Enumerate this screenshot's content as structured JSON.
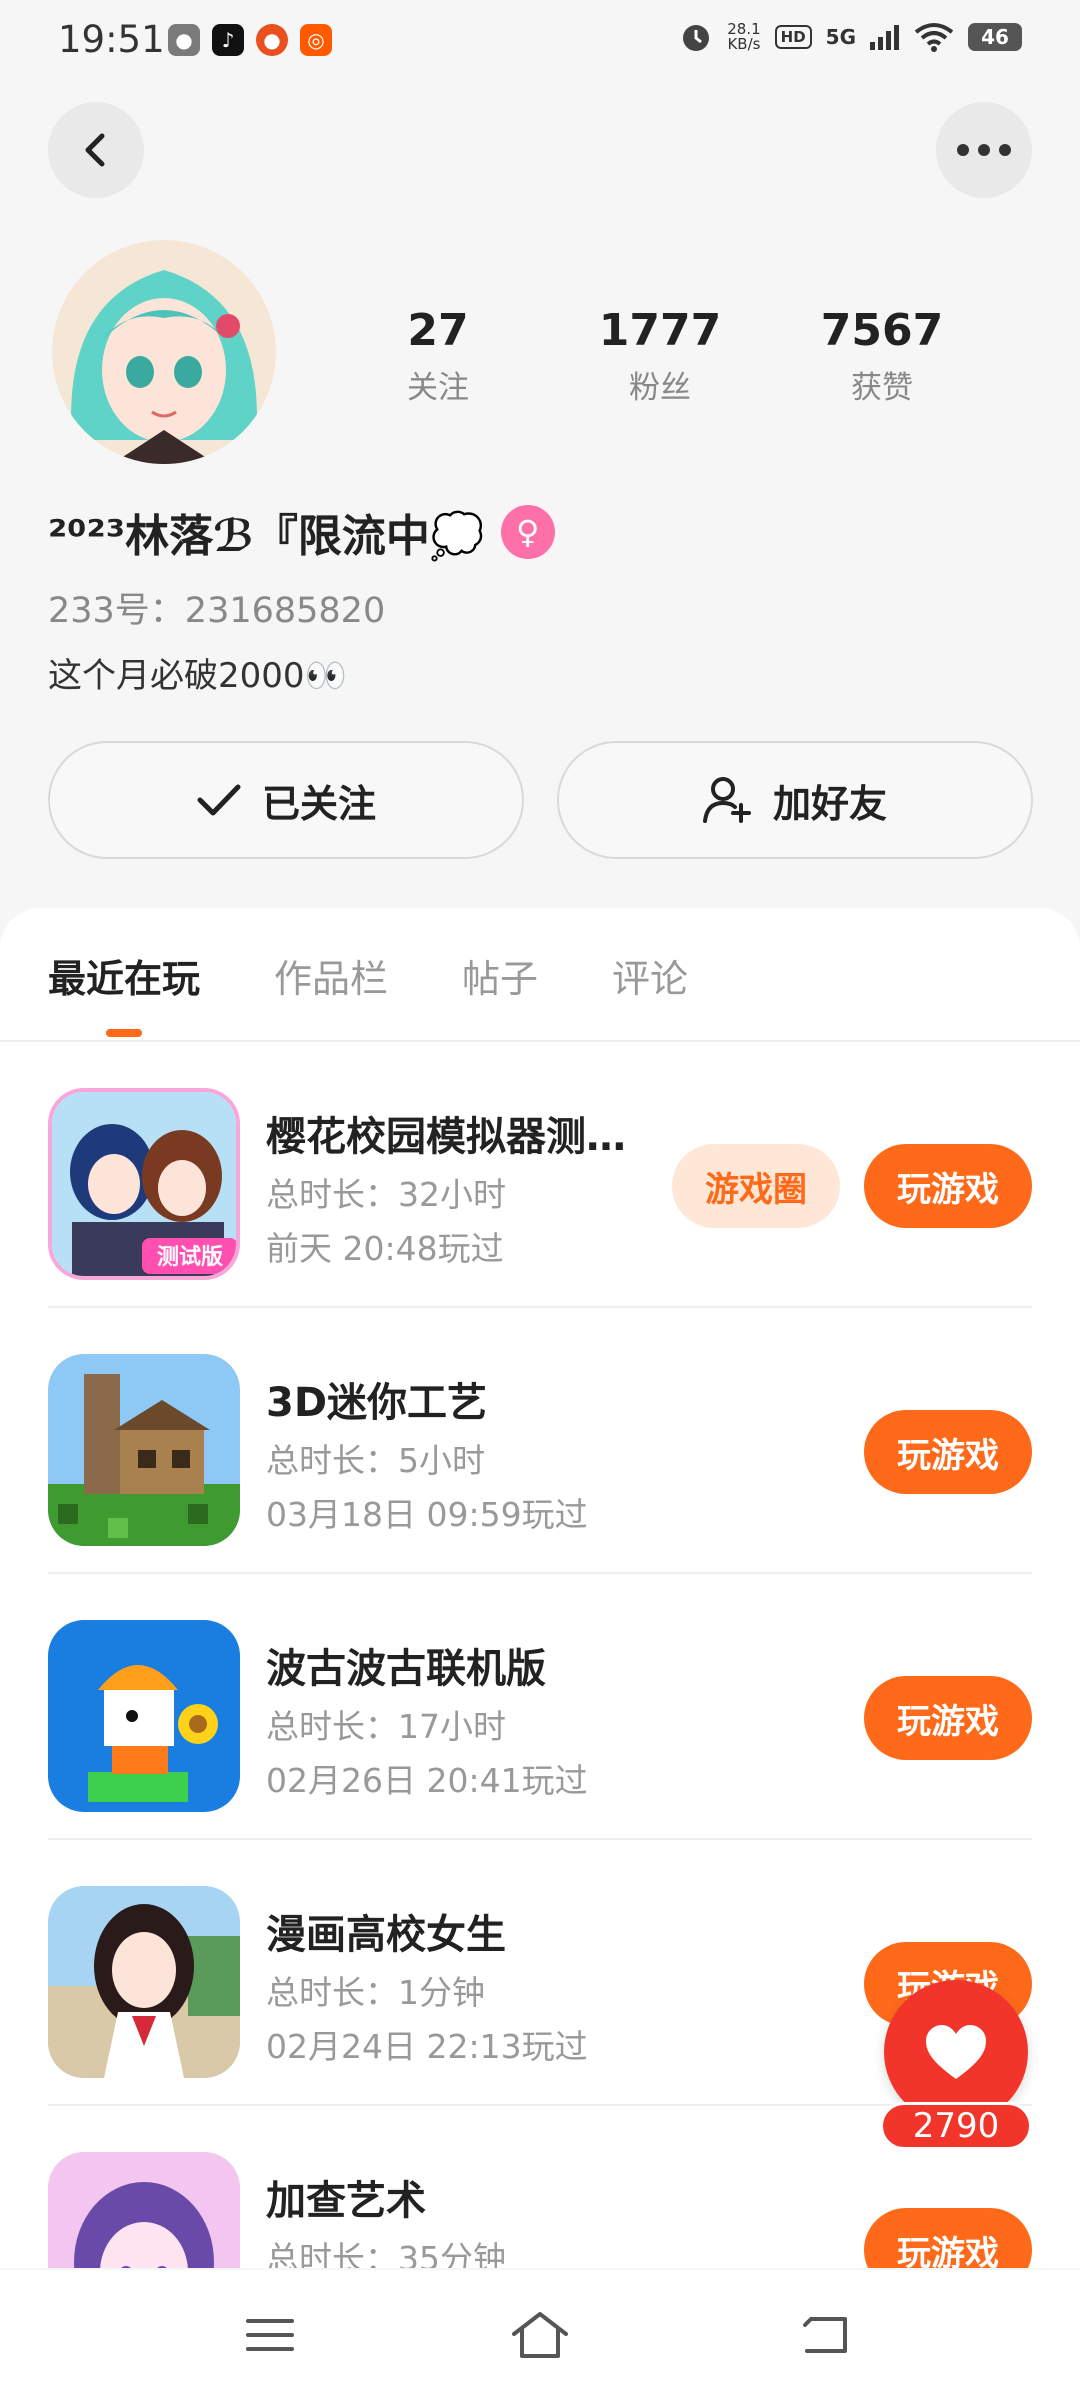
{
  "status_bar": {
    "time": "19:51",
    "speed_value": "28.1",
    "speed_unit": "KB/s",
    "hd": "HD",
    "network": "5G",
    "battery": "46",
    "app_icons": [
      "wechat-icon",
      "tiktok-icon",
      "weibo-icon",
      "taobao-icon"
    ]
  },
  "profile": {
    "nickname": "²⁰²³林落ℬ『限流中💭",
    "gender": "female",
    "user_id": "233号：231685820",
    "bio": "这个月必破2000👀",
    "stats": [
      {
        "value": "27",
        "label": "关注"
      },
      {
        "value": "1777",
        "label": "粉丝"
      },
      {
        "value": "7567",
        "label": "获赞"
      }
    ],
    "followed_label": "已关注",
    "add_friend_label": "加好友"
  },
  "tabs": [
    {
      "label": "最近在玩",
      "active": true
    },
    {
      "label": "作品栏",
      "active": false
    },
    {
      "label": "帖子",
      "active": false
    },
    {
      "label": "评论",
      "active": false
    }
  ],
  "games": [
    {
      "title": "樱花校园模拟器测…",
      "duration": "总时长：32小时",
      "last_played": "前天 20:48玩过",
      "circle_label": "游戏圈",
      "play_label": "玩游戏"
    },
    {
      "title": "3D迷你工艺",
      "duration": "总时长：5小时",
      "last_played": "03月18日 09:59玩过",
      "play_label": "玩游戏"
    },
    {
      "title": "波古波古联机版",
      "duration": "总时长：17小时",
      "last_played": "02月26日 20:41玩过",
      "play_label": "玩游戏"
    },
    {
      "title": "漫画高校女生",
      "duration": "总时长：1分钟",
      "last_played": "02月24日 22:13玩过",
      "play_label": "玩游戏"
    },
    {
      "title": "加查艺术",
      "duration": "总时长：35分钟",
      "last_played": "",
      "play_label": "玩游戏"
    }
  ],
  "floating_like": {
    "count": "2790"
  },
  "colors": {
    "accent": "#ff6a1a",
    "like": "#f2352a",
    "gender": "#ff6fa8"
  }
}
